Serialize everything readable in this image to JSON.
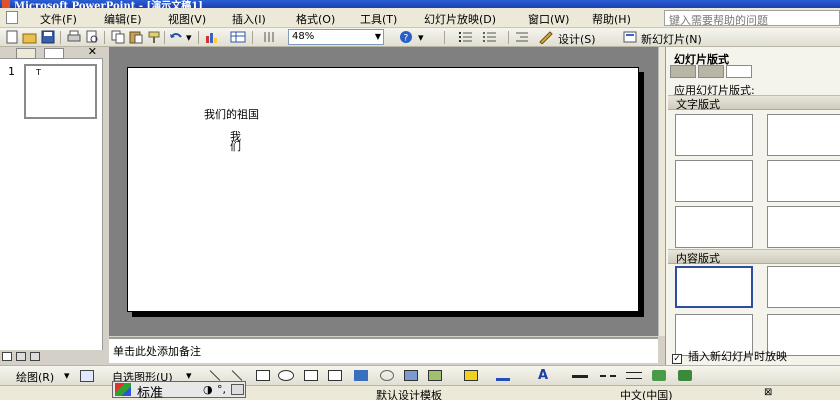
{
  "window": {
    "title": "Microsoft PowerPoint - [演示文稿1]"
  },
  "menu": {
    "items": [
      "文件(F)",
      "编辑(E)",
      "视图(V)",
      "插入(I)",
      "格式(O)",
      "工具(T)",
      "幻灯片放映(D)",
      "窗口(W)",
      "帮助(H)"
    ],
    "help_placeholder": "键入需要帮助的问题"
  },
  "toolbar": {
    "zoom": "48%",
    "design_label": "设计(S)",
    "new_slide_label": "新幻灯片(N)"
  },
  "outline": {
    "slide_number": "1",
    "thumb_text": "T"
  },
  "slide": {
    "title_text": "我们的祖国",
    "body_text": "我们"
  },
  "notes": {
    "placeholder": "单击此处添加备注"
  },
  "task_pane": {
    "title": "幻灯片版式",
    "apply_label": "应用幻灯片版式:",
    "section_text": "文字版式",
    "section_content": "内容版式",
    "show_on_insert": "插入新幻灯片时放映"
  },
  "drawing": {
    "draw_label": "绘图(R)",
    "autoshapes_label": "自选图形(U)"
  },
  "status": {
    "template": "默认设计模板",
    "language": "中文(中国)"
  },
  "ime": {
    "mode": "标准"
  }
}
